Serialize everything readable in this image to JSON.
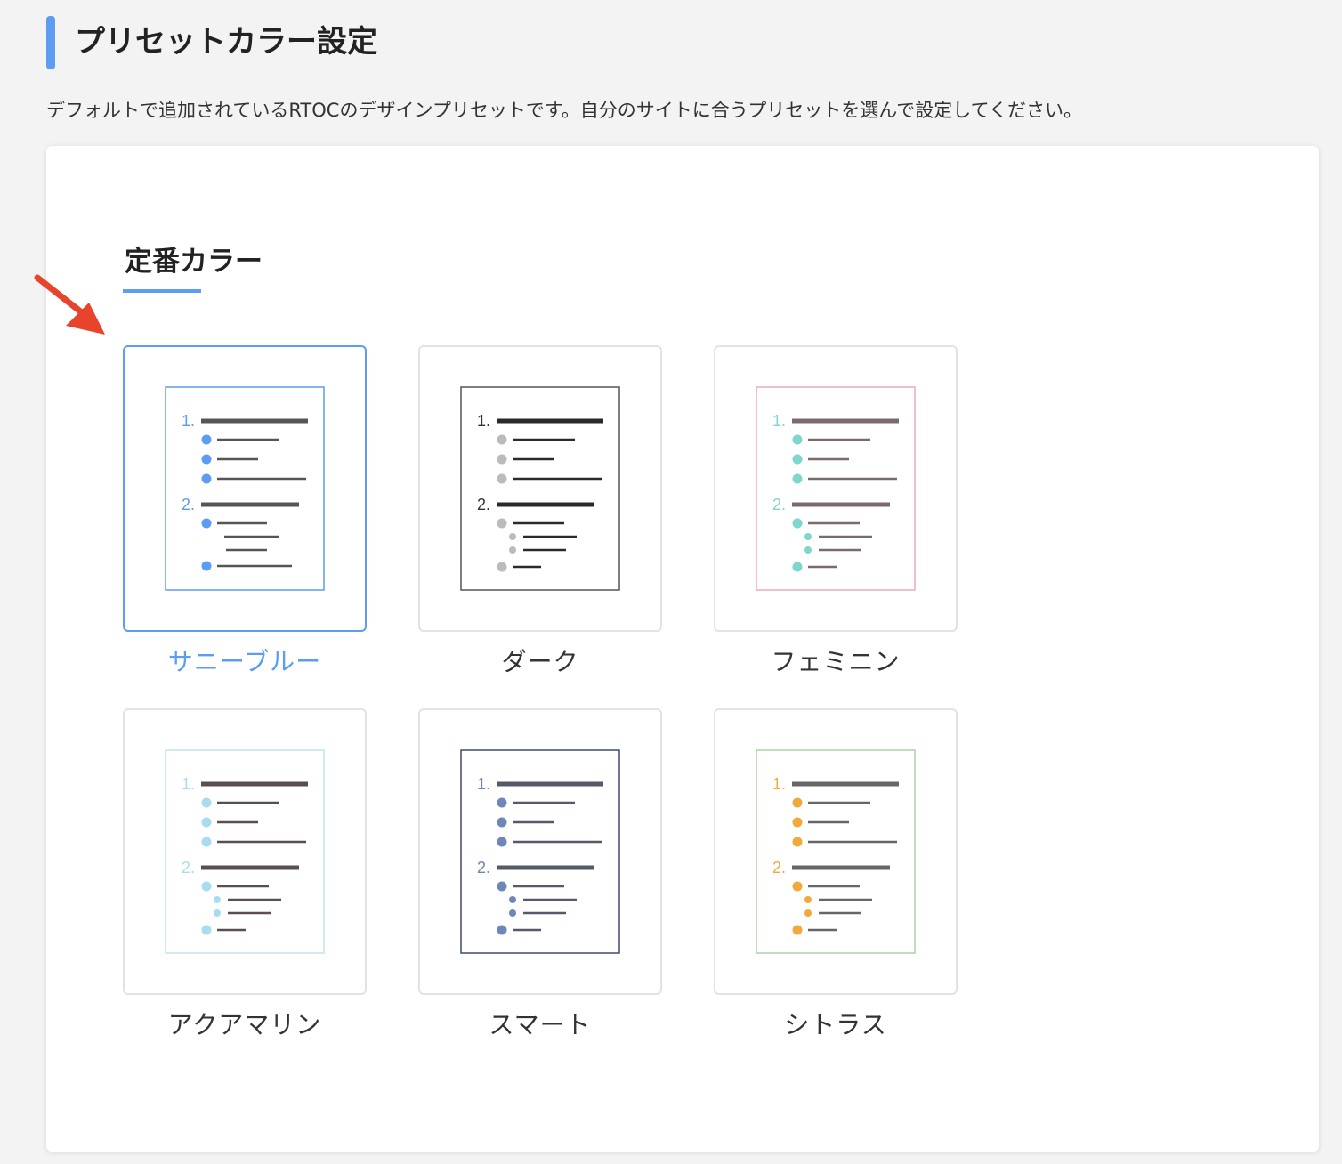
{
  "header": {
    "title": "プリセットカラー設定",
    "description": "デフォルトで追加されているRTOCのデザインプリセットです。自分のサイトに合うプリセットを選んで設定してください。",
    "accent_color": "#5c9cf2"
  },
  "section": {
    "title": "定番カラー",
    "arrow_color": "#e8432b"
  },
  "presets": [
    {
      "id": "sunny-blue",
      "label": "サニーブルー",
      "selected": true,
      "frame": "#5c9cf2",
      "number": "#5c9cf2",
      "bullet": "#5c9cf2",
      "line": "#555555",
      "variant": "a"
    },
    {
      "id": "dark",
      "label": "ダーク",
      "selected": false,
      "frame": "#555555",
      "number": "#333333",
      "bullet": "#bbbbbb",
      "line": "#2a2a2a",
      "variant": "b"
    },
    {
      "id": "feminine",
      "label": "フェミニン",
      "selected": false,
      "frame": "#f0a8c0",
      "number": "#7fd6cc",
      "bullet": "#7fd6cc",
      "line": "#7a6a70",
      "variant": "b"
    },
    {
      "id": "aquamarine",
      "label": "アクアマリン",
      "selected": false,
      "frame": "#bfe6ee",
      "number": "#a8dcef",
      "bullet": "#a8dcef",
      "line": "#5a4e52",
      "variant": "b"
    },
    {
      "id": "smart",
      "label": "スマート",
      "selected": false,
      "frame": "#3e4a6e",
      "number": "#6f86b8",
      "bullet": "#6f86b8",
      "line": "#55596a",
      "variant": "b"
    },
    {
      "id": "citrus",
      "label": "シトラス",
      "selected": false,
      "frame": "#a8d4a8",
      "number": "#f0aa3c",
      "bullet": "#f0aa3c",
      "line": "#666666",
      "variant": "b"
    }
  ]
}
